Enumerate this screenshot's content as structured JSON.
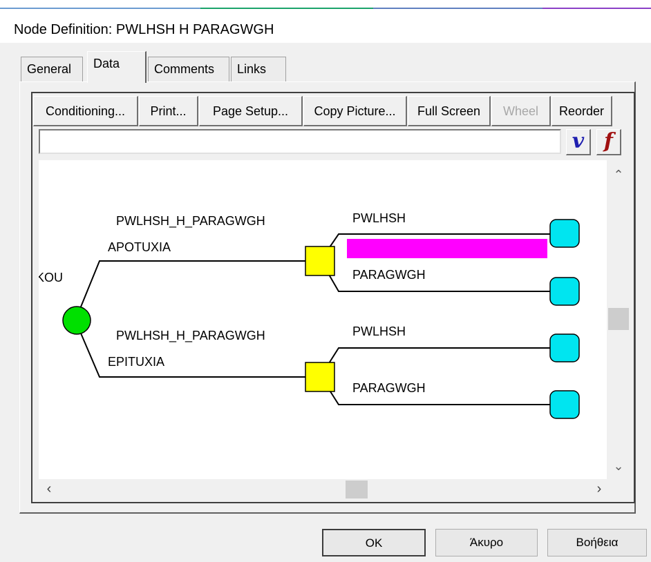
{
  "window": {
    "title": "Node Definition: PWLHSH H PARAGWGH"
  },
  "tabs": [
    "General",
    "Data",
    "Comments",
    "Links"
  ],
  "toolbar": {
    "buttons": [
      "Conditioning...",
      "Print...",
      "Page Setup...",
      "Copy Picture...",
      "Full Screen",
      "Wheel",
      "Reorder"
    ],
    "disabled": [
      "Wheel"
    ]
  },
  "formula": {
    "value": "",
    "v_label": "v",
    "f_label": "f"
  },
  "tree": {
    "root_label": "KOU",
    "branches": [
      {
        "label": "APOTUXIA",
        "decision_label": "PWLHSH_H_PARAGWGH",
        "options": [
          "PWLHSH",
          "PARAGWGH"
        ]
      },
      {
        "label": "EPITUXIA",
        "decision_label": "PWLHSH_H_PARAGWGH",
        "options": [
          "PWLHSH",
          "PARAGWGH"
        ]
      }
    ],
    "colors": {
      "chance": "#00e000",
      "decision": "#ffff00",
      "terminal": "#00e5f0",
      "highlight": "#ff00ff"
    }
  },
  "dialog_buttons": {
    "ok": "OK",
    "cancel": "Άκυρο",
    "help": "Βοήθεια"
  }
}
